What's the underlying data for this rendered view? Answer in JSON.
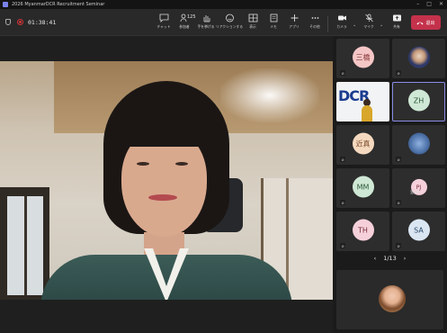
{
  "window": {
    "title": "2026 MyanmarDCR Recruitment Seminar"
  },
  "toolbar": {
    "timer": "01:38:41",
    "participants_count": "125",
    "items": [
      {
        "label": "チャット",
        "icon": "chat-icon"
      },
      {
        "label": "参加者",
        "icon": "people-icon"
      },
      {
        "label": "手を挙げる",
        "icon": "raise-hand-icon"
      },
      {
        "label": "リアクションする",
        "icon": "reaction-icon"
      },
      {
        "label": "表示",
        "icon": "view-icon"
      },
      {
        "label": "メモ",
        "icon": "notes-icon"
      },
      {
        "label": "アプリ",
        "icon": "apps-icon"
      },
      {
        "label": "その他",
        "icon": "more-icon"
      },
      {
        "label": "カメラ",
        "icon": "camera-icon"
      },
      {
        "label": "マイク",
        "icon": "mic-off-icon"
      },
      {
        "label": "共有",
        "icon": "share-icon"
      }
    ],
    "leave_label": "退出"
  },
  "participants": [
    {
      "initials": "三橋",
      "color": "#f5c6c6",
      "text_color": "#8a3a3a"
    },
    {
      "initials": "",
      "color": "#3a4a7a",
      "text_color": "#fff"
    },
    {
      "initials": "",
      "color": "#f1f3f5",
      "text_color": "#1a3b8f"
    },
    {
      "initials": "ZH",
      "color": "#cfe8d5",
      "text_color": "#2d5a3a"
    },
    {
      "initials": "近真",
      "color": "#f5d9bf",
      "text_color": "#7a4a2a"
    },
    {
      "initials": "",
      "color": "#4a6fa5",
      "text_color": "#fff"
    },
    {
      "initials": "MM",
      "color": "#cfe8d5",
      "text_color": "#2d5a3a"
    },
    {
      "initials": "PJ",
      "color": "#f5d0da",
      "text_color": "#7a2a3a",
      "tag": "室留中"
    },
    {
      "initials": "TH",
      "color": "#f5d0da",
      "text_color": "#7a2a3a"
    },
    {
      "initials": "SA",
      "color": "#dbe6f3",
      "text_color": "#2a4a6a"
    }
  ],
  "logo_text": "DCR",
  "pager": {
    "label": "1/13"
  }
}
